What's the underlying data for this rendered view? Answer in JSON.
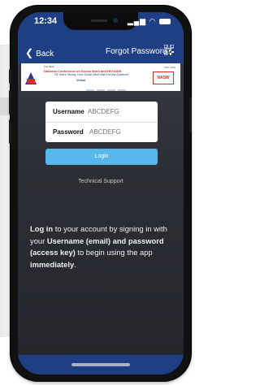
{
  "status_bar": {
    "time": "12:34",
    "signal": "▂▄▆"
  },
  "nav": {
    "back_label": "Back",
    "forgot_label": "Forgot Password?"
  },
  "banner": {
    "small_top": "The 2023",
    "line1": "National Conference on Social Work and HIV/AIDS",
    "line2": "\"25 Years Strong: How Social Work Will End the Epidemic\"",
    "line3": "Virtual",
    "date": "MAY 2023",
    "logo_text": "NASW"
  },
  "login_form": {
    "username_label": "Username",
    "username_placeholder": "ABCDEFG",
    "password_label": "Password",
    "password_placeholder": "ABCDEFG",
    "login_label": "Login"
  },
  "support_label": "Technical Support",
  "description": {
    "p1": "Log in",
    "p2": " to your account by signing in with your ",
    "p3": "Username (email) and password (access key)",
    "p4": " to begin using the app ",
    "p5": "immediately",
    "p6": "."
  },
  "colors": {
    "nav_bar": "#1f3f85",
    "login_button": "#58b7ea",
    "screen_bg": "#2c2e35"
  }
}
